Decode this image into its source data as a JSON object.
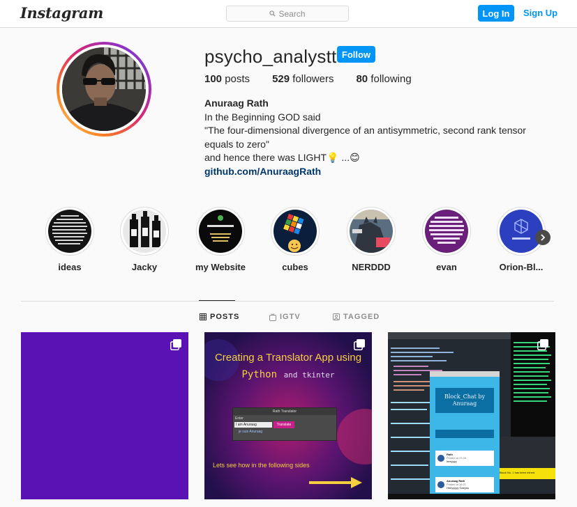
{
  "header": {
    "logo": "Instagram",
    "search_placeholder": "Search",
    "login_label": "Log In",
    "signup_label": "Sign Up",
    "accent_color": "#0095f6"
  },
  "profile": {
    "username": "psycho_analystt",
    "follow_label": "Follow",
    "posts_count": "100",
    "posts_label": "posts",
    "followers_count": "529",
    "followers_label": "followers",
    "following_count": "80",
    "following_label": "following",
    "full_name": "Anuraag Rath",
    "bio_lines": [
      "In the Beginning GOD said",
      "\"The four-dimensional divergence of an antisymmetric, second rank tensor equals to zero\"",
      "and hence there was LIGHT💡 ...😊"
    ],
    "link": "github.com/AnuraagRath"
  },
  "highlights": [
    {
      "label": "ideas",
      "icon": "text-screenshot"
    },
    {
      "label": "Jacky",
      "icon": "bottles"
    },
    {
      "label": "my Website",
      "icon": "website-preview"
    },
    {
      "label": "cubes",
      "icon": "rubiks-cube"
    },
    {
      "label": "NERDDD",
      "icon": "comic-batman"
    },
    {
      "label": "evan",
      "icon": "quote-purple"
    },
    {
      "label": "Orion-Bl...",
      "icon": "orion-logo"
    }
  ],
  "tabs": [
    {
      "label": "POSTS",
      "icon": "grid-icon",
      "active": true
    },
    {
      "label": "IGTV",
      "icon": "igtv-icon",
      "active": false
    },
    {
      "label": "TAGGED",
      "icon": "tag-icon",
      "active": false
    }
  ],
  "posts": {
    "post2": {
      "title": "Creating a Translator App using",
      "subtitle_main": "Python",
      "subtitle_rest": "and tkinter",
      "window_title": "Rath Translator",
      "input_label": "Enter",
      "input_value": "I am Anuraag",
      "button_label": "Translate",
      "output_value": "je suis Anuraag",
      "caption": "Lets see how in the following sides"
    },
    "post3": {
      "app_title_line1": "Block_Chat by",
      "app_title_line2": "Anuraag",
      "msg1_name": "Rath",
      "msg1_time": "Posted at 23:26",
      "msg1_body": "heeyyyy",
      "msg2_name": "Anuraag Rath",
      "msg2_time": "Posted at 18:27",
      "msg2_body": "Heeyyyyy Gaeyss",
      "status_text": "Block No. 1 has been mined."
    }
  }
}
